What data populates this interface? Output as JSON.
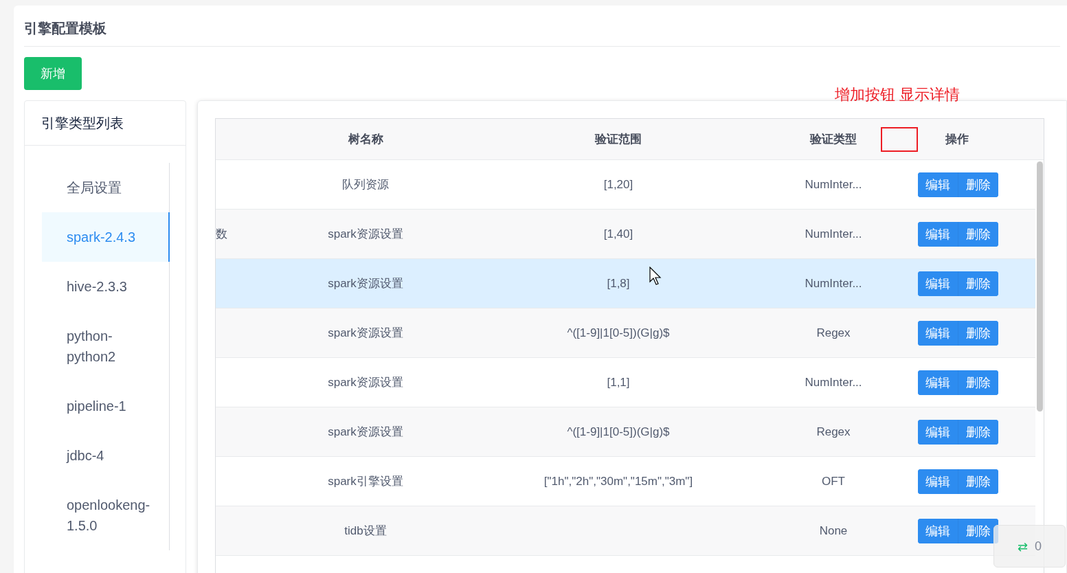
{
  "page_title": "引擎配置模板",
  "add_button": "新增",
  "sidebar": {
    "title": "引擎类型列表",
    "items": [
      {
        "label": "全局设置",
        "selected": false
      },
      {
        "label": "spark-2.4.3",
        "selected": true
      },
      {
        "label": "hive-2.3.3",
        "selected": false
      },
      {
        "label": "python-python2",
        "selected": false
      },
      {
        "label": "pipeline-1",
        "selected": false
      },
      {
        "label": "jdbc-4",
        "selected": false
      },
      {
        "label": "openlookeng-1.5.0",
        "selected": false
      }
    ]
  },
  "annotation": {
    "note": "增加按钮 显示详情"
  },
  "table": {
    "columns": [
      "树名称",
      "验证范围",
      "验证类型",
      "操作"
    ],
    "rows": [
      {
        "column_1": "",
        "tree_name": "队列资源",
        "range": "[1,20]",
        "type": "NumInter...",
        "highlighted": false,
        "edit": "编辑",
        "delete": "删除"
      },
      {
        "column_1": "数",
        "tree_name": "spark资源设置",
        "range": "[1,40]",
        "type": "NumInter...",
        "highlighted": false,
        "edit": "编辑",
        "delete": "删除"
      },
      {
        "column_1": "",
        "tree_name": "spark资源设置",
        "range": "[1,8]",
        "type": "NumInter...",
        "highlighted": true,
        "edit": "编辑",
        "delete": "删除"
      },
      {
        "column_1": "",
        "tree_name": "spark资源设置",
        "range": "^([1-9]|1[0-5])(G|g)$",
        "type": "Regex",
        "highlighted": false,
        "edit": "编辑",
        "delete": "删除"
      },
      {
        "column_1": "",
        "tree_name": "spark资源设置",
        "range": "[1,1]",
        "type": "NumInter...",
        "highlighted": false,
        "edit": "编辑",
        "delete": "删除"
      },
      {
        "column_1": "",
        "tree_name": "spark资源设置",
        "range": "^([1-9]|1[0-5])(G|g)$",
        "type": "Regex",
        "highlighted": false,
        "edit": "编辑",
        "delete": "删除"
      },
      {
        "column_1": "",
        "tree_name": "spark引擎设置",
        "range": "[\"1h\",\"2h\",\"30m\",\"15m\",\"3m\"]",
        "type": "OFT",
        "highlighted": false,
        "edit": "编辑",
        "delete": "删除"
      },
      {
        "column_1": "",
        "tree_name": "tidb设置",
        "range": "",
        "type": "None",
        "highlighted": false,
        "edit": "编辑",
        "delete": "删除"
      }
    ]
  },
  "float_widget": {
    "icon": "⇄",
    "count": "0"
  }
}
